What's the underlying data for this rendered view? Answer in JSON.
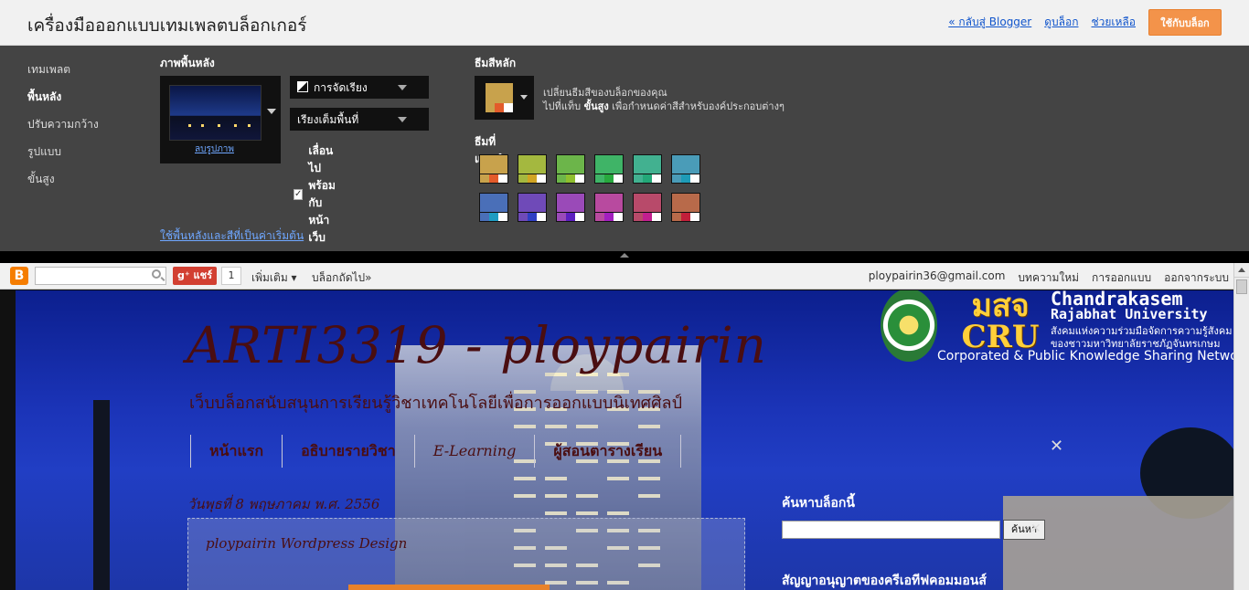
{
  "header": {
    "title": "เครื่องมือออกแบบเทมเพลตบล็อกเกอร์",
    "back_link": "« กลับสู่ Blogger",
    "view_blog": "ดูบล็อก",
    "help": "ช่วยเหลือ",
    "apply_button": "ใช้กับบล็อก"
  },
  "nav": {
    "items": [
      "เทมเพลต",
      "พื้นหลัง",
      "ปรับความกว้าง",
      "รูปแบบ",
      "ขั้นสูง"
    ],
    "active": "พื้นหลัง"
  },
  "background": {
    "heading": "ภาพพื้นหลัง",
    "remove_image": "ลบรูปภาพ",
    "alignment_dropdown": "การจัดเรียง",
    "fill_dropdown": "เรียงเต็มพื้นที่",
    "scroll_checkbox_label": "เลื่อนไปพร้อมกับหน้าเว็บ",
    "scroll_checked": true,
    "reset_link": "ใช้พื้นหลังและสีที่เป็นค่าเริ่มต้น"
  },
  "theme": {
    "heading": "ธีมสีหลัก",
    "desc_line1": "เปลี่ยนธีมสีของบล็อกของคุณ",
    "desc_line2_prefix": "ไปที่แท็บ ",
    "desc_line2_bold": "ขั้นสูง",
    "desc_line2_suffix": " เพื่อกำหนดค่าสีสำหรับองค์ประกอบต่างๆ",
    "main_color": "#c8a24c",
    "main_accents": [
      "#c8a24c",
      "#e35b2a",
      "#ffffff"
    ],
    "recommended_heading": "ธีมที่แนะนำ",
    "recommended": [
      {
        "main": "#c8a24c",
        "a1": "#e35b2a",
        "a2": "#c8a24c"
      },
      {
        "main": "#a4b83f",
        "a1": "#d0a422",
        "a2": "#a4b83f"
      },
      {
        "main": "#6cb54a",
        "a1": "#8fbf2e",
        "a2": "#6cb54a"
      },
      {
        "main": "#3fb467",
        "a1": "#28a93e",
        "a2": "#3fb467"
      },
      {
        "main": "#42b190",
        "a1": "#23a878",
        "a2": "#42b190"
      },
      {
        "main": "#4a9cb8",
        "a1": "#1e9bb7",
        "a2": "#4a9cb8"
      },
      {
        "main": "#4a6fb8",
        "a1": "#1e9cc2",
        "a2": "#4a6fb8"
      },
      {
        "main": "#6f4ab8",
        "a1": "#2f3fc4",
        "a2": "#6f4ab8"
      },
      {
        "main": "#9a4ab8",
        "a1": "#5c1fbf",
        "a2": "#9a4ab8"
      },
      {
        "main": "#b84a9f",
        "a1": "#a31fbf",
        "a2": "#b84a9f"
      },
      {
        "main": "#b84a6a",
        "a1": "#c21f8f",
        "a2": "#b84a6a"
      },
      {
        "main": "#b86a4a",
        "a1": "#c21f3a",
        "a2": "#b86a4a"
      }
    ]
  },
  "preview": {
    "navbar": {
      "gplus_label": "แชร์",
      "gplus_count": "1",
      "more": "เพิ่มเติม ▾",
      "next_blog": "บล็อกถัดไป»",
      "email": "ploypairin36@gmail.com",
      "new_post": "บทความใหม่",
      "design": "การออกแบบ",
      "sign_out": "ออกจากระบบ"
    },
    "blog": {
      "title": "ARTI3319 - ploypairin",
      "description": "เว็บบล็อกสนับสนุนการเรียนรู้วิชาเทคโนโลยีเพื่อการออกแบบนิเทศศิลป์",
      "tabs": [
        "หน้าแรก",
        "อธิบายรายวิชา",
        "E-Learning",
        "ผู้สอนตารางเรียน"
      ],
      "date": "วันพุธที่ 8 พฤษภาคม พ.ศ. 2556",
      "post_title": "ploypairin Wordpress Design",
      "sidebar_heading": "ค้นหาบล็อกนี้",
      "search_button": "ค้นหา",
      "sidebar_heading2": "สัญญาอนุญาตของครีเอทีฟคอมมอนส์",
      "cru_logo": "มสจ\nCRU",
      "cru_name1": "Chandrakasem",
      "cru_name2": "Rajabhat University",
      "cru_thai1": "สังคมแห่งความร่วมมือจัดการความรู้สังคม",
      "cru_thai2": "ของชาวมหาวิทยาลัยราชภัฏจันทรเกษม",
      "cru_english": "Corporated & Public Knowledge Sharing Network"
    }
  }
}
